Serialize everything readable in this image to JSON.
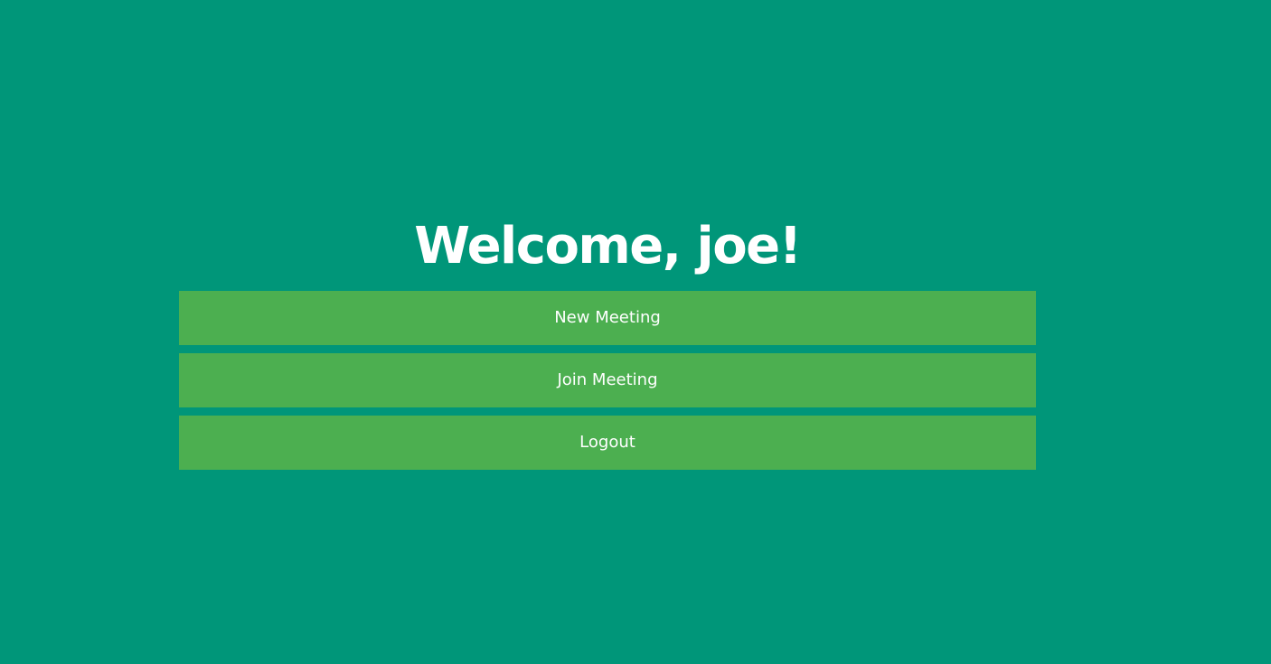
{
  "welcome": {
    "title": "Welcome, joe!"
  },
  "actions": {
    "new_meeting_label": "New Meeting",
    "join_meeting_label": "Join Meeting",
    "logout_label": "Logout"
  },
  "colors": {
    "background": "#009679",
    "button": "#4caf50",
    "text": "#ffffff"
  }
}
